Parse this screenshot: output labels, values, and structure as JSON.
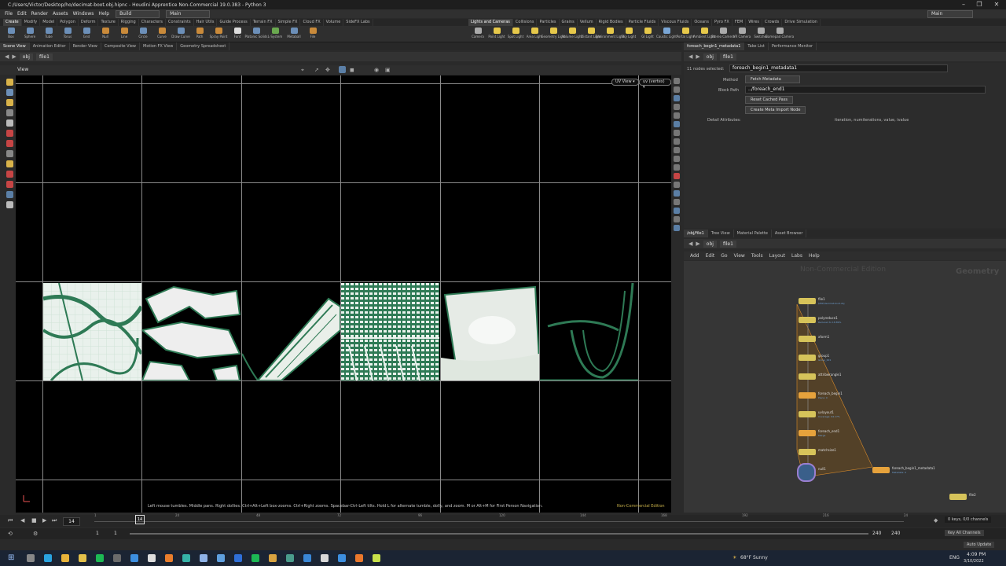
{
  "window": {
    "title": "C:/Users/Victor/Desktop/ho/decimat-boot.obj.hipnc - Houdini Apprentice Non-Commercial 19.0.383 - Python 3",
    "controls": [
      "–",
      "❐",
      "✕"
    ]
  },
  "menubar": {
    "items": [
      "File",
      "Edit",
      "Render",
      "Assets",
      "Windows",
      "Help"
    ],
    "build_desk": "Build",
    "main_desk": "Main",
    "right_desk": "Main"
  },
  "shelf_tabs_left": [
    "Create",
    "Modify",
    "Model",
    "Polygon",
    "Deform",
    "Texture",
    "Rigging",
    "Characters",
    "Constraints",
    "Hair Utils",
    "Guide Process",
    "Terrain FX",
    "Simple FX",
    "Cloud FX",
    "Volume",
    "SideFX Labs"
  ],
  "shelf_tabs_right": [
    "Lights and Cameras",
    "Collisions",
    "Particles",
    "Grains",
    "Vellum",
    "Rigid Bodies",
    "Particle Fluids",
    "Viscous Fluids",
    "Oceans",
    "Pyro FX",
    "FEM",
    "Wires",
    "Crowds",
    "Drive Simulation"
  ],
  "shelf_tools_left": [
    {
      "label": "Box",
      "color": "#6c8fb8"
    },
    {
      "label": "Sphere",
      "color": "#6c8fb8"
    },
    {
      "label": "Tube",
      "color": "#6c8fb8"
    },
    {
      "label": "Torus",
      "color": "#6c8fb8"
    },
    {
      "label": "Grid",
      "color": "#6c8fb8"
    },
    {
      "label": "Null",
      "color": "#c98a3a"
    },
    {
      "label": "Line",
      "color": "#c98a3a"
    },
    {
      "label": "Circle",
      "color": "#6c8fb8"
    },
    {
      "label": "Curve",
      "color": "#c98a3a"
    },
    {
      "label": "Draw Curve",
      "color": "#6c8fb8"
    },
    {
      "label": "Path",
      "color": "#c98a3a"
    },
    {
      "label": "Spray Paint",
      "color": "#c98a3a"
    },
    {
      "label": "Font",
      "color": "#dddddd"
    },
    {
      "label": "Platonic Solids",
      "color": "#6c8fb8"
    },
    {
      "label": "L-System",
      "color": "#6aa84f"
    },
    {
      "label": "Metaball",
      "color": "#6c8fb8"
    },
    {
      "label": "File",
      "color": "#c98a3a"
    }
  ],
  "shelf_tools_right": [
    {
      "label": "Camera",
      "color": "#aaaaaa"
    },
    {
      "label": "Point Light",
      "color": "#e6c84a"
    },
    {
      "label": "Spot Light",
      "color": "#e6c84a"
    },
    {
      "label": "Area Light",
      "color": "#e6c84a"
    },
    {
      "label": "Geometry Light",
      "color": "#e6c84a"
    },
    {
      "label": "Volume Light",
      "color": "#e6c84a"
    },
    {
      "label": "Distant Light",
      "color": "#e6c84a"
    },
    {
      "label": "Environment Light",
      "color": "#e6c84a"
    },
    {
      "label": "Sky Light",
      "color": "#e6c84a"
    },
    {
      "label": "GI Light",
      "color": "#e6c84a"
    },
    {
      "label": "Caustic Light",
      "color": "#7aa6d6"
    },
    {
      "label": "Portal Light",
      "color": "#e6c84a"
    },
    {
      "label": "Ambient Light",
      "color": "#e6c84a"
    },
    {
      "label": "Stereo Camera",
      "color": "#aaaaaa"
    },
    {
      "label": "VR Camera",
      "color": "#aaaaaa"
    },
    {
      "label": "Switcher",
      "color": "#aaaaaa"
    },
    {
      "label": "Gamepad Camera",
      "color": "#aaaaaa"
    }
  ],
  "pane_tabs_left": [
    "Scene View",
    "Animation Editor",
    "Render View",
    "Composite View",
    "Motion FX View",
    "Geometry Spreadsheet"
  ],
  "pane_tabs_right": [
    "foreach_begin1_metadata1",
    "Take List",
    "Performance Monitor"
  ],
  "path_left": {
    "root": "obj",
    "node": "file1"
  },
  "path_right": {
    "root": "obj",
    "node": "file1"
  },
  "viewport": {
    "label": "View",
    "uv_view_btn": "UV View ▾",
    "uv_attr_btn": "uv (vertex) ▾",
    "hint": "Left mouse tumbles. Middle pans. Right dollies. Ctrl+Alt+Left box-zooms. Ctrl+Right zooms. Spacebar-Ctrl-Left tilts. Hold L for alternate tumble, dolly, and zoom.     M or Alt+M for First Person Navigation.",
    "watermark": "Non-Commercial Edition"
  },
  "params": {
    "nodes_selected": "11 nodes selected:",
    "node_name": "foreach_begin1_metadata1",
    "method_label": "Method",
    "method_value": "Fetch Metadata",
    "block_path_label": "Block Path",
    "block_path_value": "../foreach_end1",
    "reset_btn": "Reset Cached Pass",
    "create_btn": "Create Meta Import Node",
    "detail_label": "Detail Attributes:",
    "detail_value": "iteration, numiterations, value, ivalue"
  },
  "network_tabs": [
    "/obj/file1",
    "Tree View",
    "Material Palette",
    "Asset Browser"
  ],
  "network_path": {
    "root": "obj",
    "node": "file1"
  },
  "network_menu": [
    "Add",
    "Edit",
    "Go",
    "View",
    "Tools",
    "Layout",
    "Labs",
    "Help"
  ],
  "network": {
    "watermark": "Non-Commercial Edition",
    "context": "Geometry",
    "nodes": [
      {
        "name": "file1",
        "sub": "$HIP/decimat-boot.obj",
        "color": "#d6c35a"
      },
      {
        "name": "polyreduce1",
        "sub": "Reduced to 18.89%",
        "color": "#d6c35a"
      },
      {
        "name": "xform1",
        "sub": "",
        "color": "#d6c35a"
      },
      {
        "name": "group1",
        "sub": "Group_001",
        "color": "#d6c35a"
      },
      {
        "name": "attribwrangle1",
        "sub": "",
        "color": "#d6c35a"
      },
      {
        "name": "foreach_begin1",
        "sub": "Piece: 0",
        "color": "#e6a23c"
      },
      {
        "name": "uvlayout1",
        "sub": "Coverage: 64.17%",
        "color": "#d6c35a"
      },
      {
        "name": "foreach_end1",
        "sub": "Merge",
        "color": "#e6a23c"
      },
      {
        "name": "matchsize1",
        "sub": "",
        "color": "#d6c35a"
      },
      {
        "name": "null1",
        "sub": "",
        "color": "#4fa0c8"
      },
      {
        "name": "foreach_begin1_metadata1",
        "sub": "Metadata: 0",
        "color": "#e6a23c"
      },
      {
        "name": "file2",
        "sub": "",
        "color": "#d6c35a"
      }
    ]
  },
  "timeline": {
    "current_frame": "14",
    "marker": "14",
    "ticks": [
      "1",
      "24",
      "48",
      "72",
      "96",
      "120",
      "144",
      "168",
      "192",
      "216",
      "24"
    ],
    "start": "1",
    "start2": "1",
    "end": "240",
    "end2": "240",
    "keys_info": "0 keys, 0/0 channels",
    "key_all": "Key All Channels",
    "auto_update": "Auto Update"
  },
  "taskbar": {
    "weather": "68°F  Sunny",
    "lang": "ENG",
    "time": "4:09 PM",
    "date": "3/10/2022",
    "apps": [
      "search",
      "telegram",
      "chrome",
      "explorer",
      "spotify",
      "store",
      "mail",
      "unity",
      "blender",
      "maya",
      "lightroom",
      "lightroom-classic",
      "photoshop",
      "spotify2",
      "nuke",
      "screen",
      "vscode",
      "paint",
      "mail2",
      "houdini",
      "substance-designer"
    ]
  }
}
